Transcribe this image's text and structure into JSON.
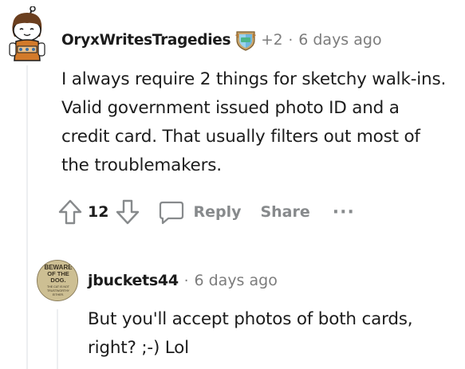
{
  "op_comment": {
    "username": "OryxWritesTragedies",
    "award_count": "+2",
    "separator": "·",
    "timestamp": "6 days ago",
    "body": "I always require 2 things for sketchy walk-ins. Valid government issued photo ID and a credit card. That usually filters out most of the troublemakers.",
    "vote_count": "12",
    "reply_label": "Reply",
    "share_label": "Share",
    "more_label": "···",
    "icons": {
      "flair": "shield-award-icon",
      "upvote": "upvote-arrow-icon",
      "downvote": "downvote-arrow-icon",
      "reply": "speech-bubble-icon",
      "more": "more-dots-icon"
    }
  },
  "reply_comment": {
    "username": "jbuckets44",
    "separator": "·",
    "timestamp": "6 days ago",
    "body": "But you'll accept photos of both cards, right? ;-) Lol",
    "avatar_text": {
      "line1": "BEWARE",
      "line2": "OF THE",
      "line3": "DOG.",
      "line4": "THE CAT IS NOT",
      "line5": "TRUSTWORTHY",
      "line6": "EITHER."
    }
  },
  "colors": {
    "text_primary": "#1c1c1c",
    "text_muted": "#7c7c7c",
    "action_gray": "#878a8c",
    "thread_line": "#edeff1",
    "background": "#ffffff"
  }
}
